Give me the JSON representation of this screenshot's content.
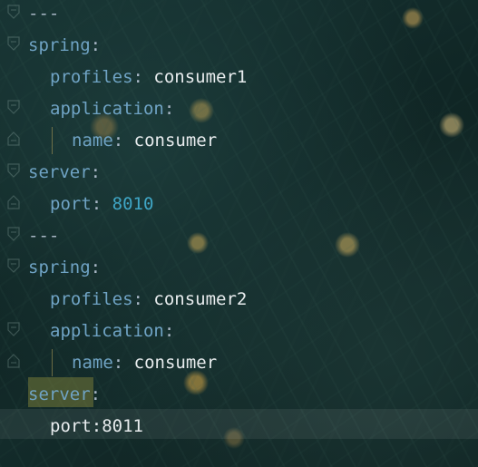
{
  "editor": {
    "lines": [
      {
        "indent": 0,
        "type": "separator",
        "text": "---"
      },
      {
        "indent": 0,
        "type": "key",
        "key": "spring",
        "sep": ":"
      },
      {
        "indent": 1,
        "type": "pair",
        "key": "profiles",
        "sep": ":",
        "value": " consumer1",
        "valueKind": "string"
      },
      {
        "indent": 1,
        "type": "key",
        "key": "application",
        "sep": ":"
      },
      {
        "indent": 2,
        "type": "pair",
        "key": "name",
        "sep": ":",
        "value": " consumer",
        "valueKind": "string"
      },
      {
        "indent": 0,
        "type": "key",
        "key": "server",
        "sep": ":"
      },
      {
        "indent": 1,
        "type": "pair",
        "key": "port",
        "sep": ":",
        "value": " 8010",
        "valueKind": "number"
      },
      {
        "indent": 0,
        "type": "separator",
        "text": "---"
      },
      {
        "indent": 0,
        "type": "key",
        "key": "spring",
        "sep": ":"
      },
      {
        "indent": 1,
        "type": "pair",
        "key": "profiles",
        "sep": ":",
        "value": " consumer2",
        "valueKind": "string"
      },
      {
        "indent": 1,
        "type": "key",
        "key": "application",
        "sep": ":"
      },
      {
        "indent": 2,
        "type": "pair",
        "key": "name",
        "sep": ":",
        "value": " consumer",
        "valueKind": "string"
      },
      {
        "indent": 0,
        "type": "key",
        "key": "server",
        "sep": ":",
        "highlighted": true
      },
      {
        "indent": 1,
        "type": "plain",
        "text": "port:8011",
        "current": true
      }
    ]
  },
  "colors": {
    "key": "#6fa3c4",
    "value": "#e8ecee",
    "number": "#3fa6c6",
    "punct": "#a9b7c6",
    "highlight": "#8c8c3c"
  },
  "icons": {
    "fold": "fold-marker-icon"
  }
}
